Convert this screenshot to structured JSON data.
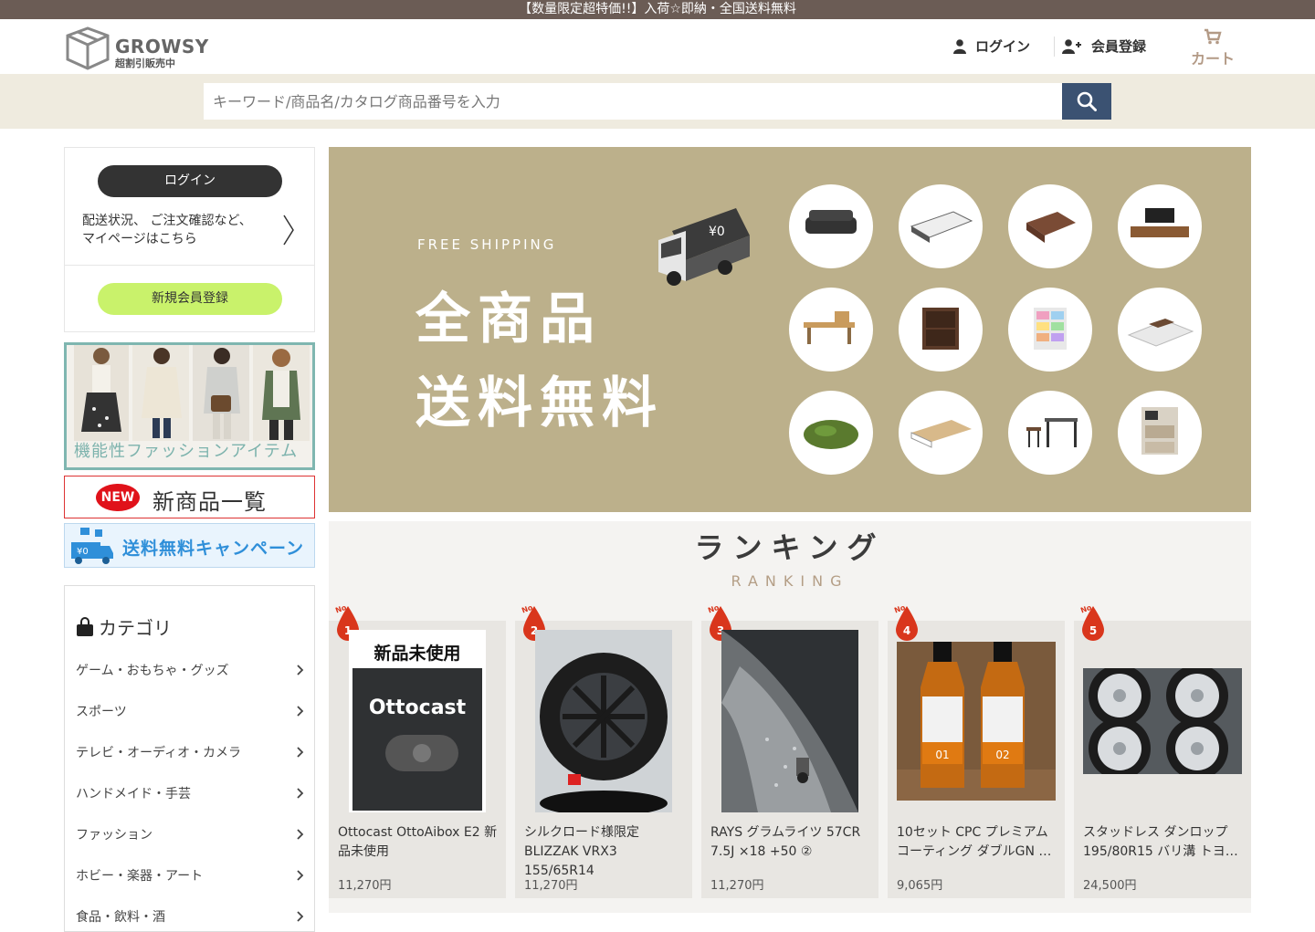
{
  "announcement": "【数量限定超特価!!】入荷☆即納・全国送料無料",
  "header": {
    "logo_text": "GROWSY",
    "logo_sub": "超割引販売中",
    "login": "ログイン",
    "register": "会員登録",
    "cart": "カート",
    "icons": {
      "login": "user-icon",
      "register": "user-plus-icon",
      "cart": "cart-icon"
    }
  },
  "search": {
    "placeholder": "キーワード/商品名/カタログ商品番号を入力",
    "value": "",
    "button_icon": "search-icon"
  },
  "sidebar": {
    "login_button": "ログイン",
    "description": "配送状況、 ご注文確認など、\nマイページはこちら",
    "register_button": "新規会員登録",
    "fashion_banner": "機能性ファッションアイテム",
    "new_badge": "NEW",
    "new_banner": "新商品一覧",
    "shipping_banner": "送料無料キャンペーン",
    "shipping_badge": "¥0",
    "category_title": "カテゴリ",
    "categories": [
      "ゲーム・おもちゃ・グッズ",
      "スポーツ",
      "テレビ・オーディオ・カメラ",
      "ハンドメイド・手芸",
      "ファッション",
      "ホビー・楽器・アート",
      "食品・飲料・酒"
    ]
  },
  "hero": {
    "free_shipping": "FREE SHIPPING",
    "line1": "全商品",
    "line2": "送料無料",
    "truck_label": "¥0"
  },
  "ranking": {
    "title": "ランキング",
    "subtitle": "RANKING",
    "no_label": "No.",
    "items": [
      {
        "rank": "1",
        "name": "Ottocast OttoAibox E2 新品未使用",
        "price": "11,270円",
        "img_caption": "新品未使用",
        "img_brand": "Ottocast"
      },
      {
        "rank": "2",
        "name": "シルクロード様限定 BLIZZAK VRX3 155/65R14",
        "price": "11,270円"
      },
      {
        "rank": "3",
        "name": "RAYS グラムライツ 57CR 7.5J ×18 +50 ②",
        "price": "11,270円"
      },
      {
        "rank": "4",
        "name": "10セット CPC プレミアム コーティング ダブルGN …",
        "price": "9,065円",
        "img_labels": [
          "01",
          "02"
        ]
      },
      {
        "rank": "5",
        "name": "スタッドレス ダンロップ 195/80R15 バリ溝 トヨ…",
        "price": "24,500円"
      }
    ]
  },
  "colors": {
    "announcement_bg": "#6b5c55",
    "search_bg": "#efebdf",
    "search_button": "#3b5272",
    "hero_bg": "#bcb08b",
    "register_button": "#c9f26b",
    "rank_badge": "#d9361c"
  }
}
